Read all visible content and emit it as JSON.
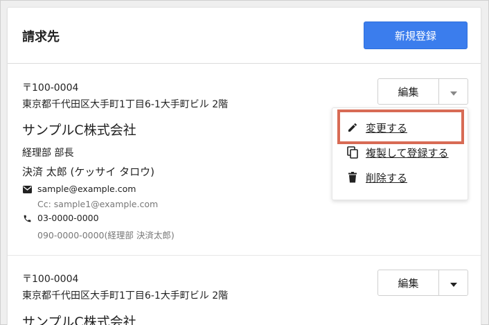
{
  "header": {
    "title": "請求先",
    "new_button": "新規登録"
  },
  "entries": [
    {
      "zip": "〒100-0004",
      "address": "東京都千代田区大手町1丁目6-1大手町ビル 2階",
      "company": "サンプルC株式会社",
      "department": "経理部 部長",
      "person": "決済 太郎 (ケッサイ タロウ)",
      "email": "sample@example.com",
      "cc": "Cc: sample1@example.com",
      "phone": "03-0000-0000",
      "phone_sub": "090-0000-0000(経理部 決済太郎)",
      "edit_label": "編集"
    },
    {
      "zip": "〒100-0004",
      "address": "東京都千代田区大手町1丁目6-1大手町ビル 2階",
      "company": "サンプルC株式会社",
      "edit_label": "編集"
    }
  ],
  "menu": {
    "items": [
      {
        "label": "変更する",
        "icon": "pencil-icon"
      },
      {
        "label": "複製して登録する",
        "icon": "copy-icon"
      },
      {
        "label": "削除する",
        "icon": "trash-icon"
      }
    ]
  },
  "colors": {
    "primary": "#3b7ded",
    "highlight": "#d86b55"
  }
}
